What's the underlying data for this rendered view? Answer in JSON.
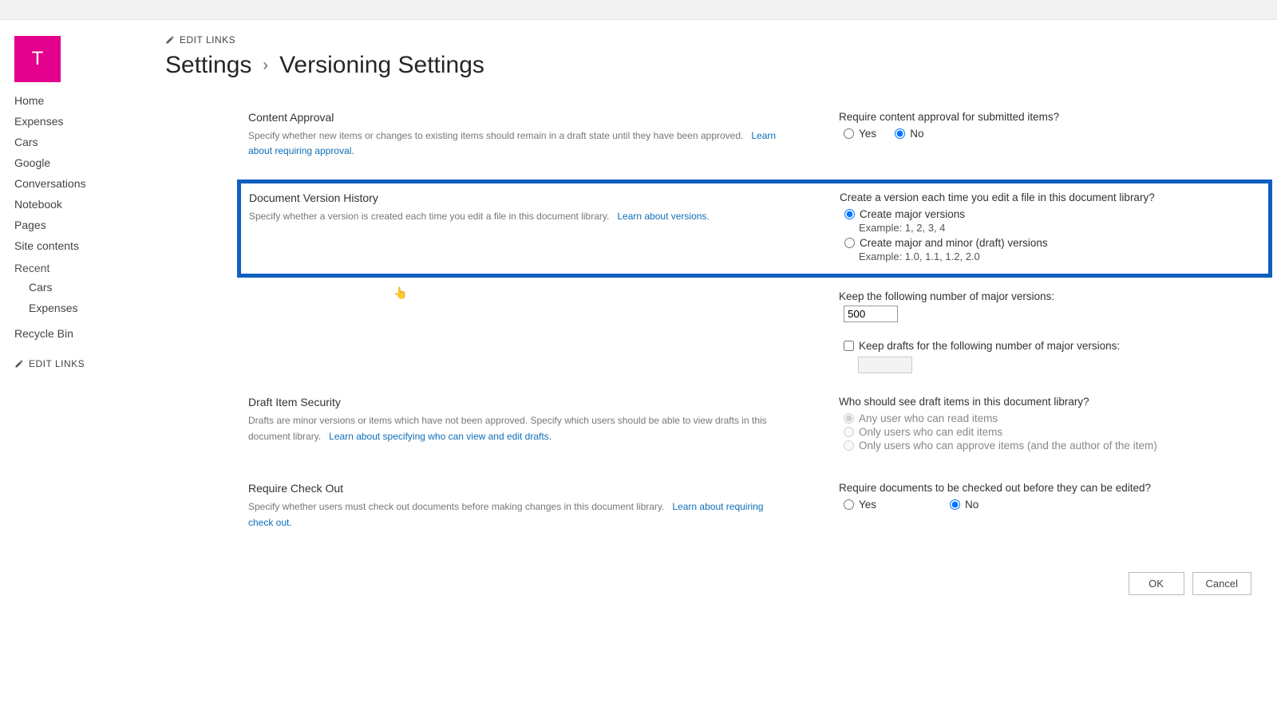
{
  "tile": {
    "letter": "T"
  },
  "edit_links_label": "EDIT LINKS",
  "breadcrumb": {
    "root": "Settings",
    "sep": "›",
    "current": "Versioning Settings"
  },
  "sidebar": {
    "items": [
      {
        "label": "Home"
      },
      {
        "label": "Expenses"
      },
      {
        "label": "Cars"
      },
      {
        "label": "Google"
      },
      {
        "label": "Conversations"
      },
      {
        "label": "Notebook"
      },
      {
        "label": "Pages"
      },
      {
        "label": "Site contents"
      }
    ],
    "recent_heading": "Recent",
    "recent": [
      {
        "label": "Cars"
      },
      {
        "label": "Expenses"
      }
    ],
    "recycle": "Recycle Bin"
  },
  "section_content_approval": {
    "title": "Content Approval",
    "desc": "Specify whether new items or changes to existing items should remain in a draft state until they have been approved.",
    "learn": "Learn about requiring approval.",
    "question": "Require content approval for submitted items?",
    "yes": "Yes",
    "no": "No"
  },
  "section_version_history": {
    "title": "Document Version History",
    "desc": "Specify whether a version is created each time you edit a file in this document library.",
    "learn": "Learn about versions.",
    "question": "Create a version each time you edit a file in this document library?",
    "opt_major": "Create major versions",
    "ex_major": "Example: 1, 2, 3, 4",
    "opt_minor": "Create major and minor (draft) versions",
    "ex_minor": "Example: 1.0, 1.1, 1.2, 2.0",
    "keep_major_label": "Keep the following number of major versions:",
    "keep_major_value": "500",
    "keep_drafts_label": "Keep drafts for the following number of major versions:",
    "keep_drafts_value": ""
  },
  "section_draft_security": {
    "title": "Draft Item Security",
    "desc": "Drafts are minor versions or items which have not been approved. Specify which users should be able to view drafts in this document library.",
    "learn": "Learn about specifying who can view and edit drafts.",
    "question": "Who should see draft items in this document library?",
    "opt_read": "Any user who can read items",
    "opt_edit": "Only users who can edit items",
    "opt_approve": "Only users who can approve items (and the author of the item)"
  },
  "section_checkout": {
    "title": "Require Check Out",
    "desc": "Specify whether users must check out documents before making changes in this document library.",
    "learn": "Learn about requiring check out.",
    "question": "Require documents to be checked out before they can be edited?",
    "yes": "Yes",
    "no": "No"
  },
  "buttons": {
    "ok": "OK",
    "cancel": "Cancel"
  }
}
